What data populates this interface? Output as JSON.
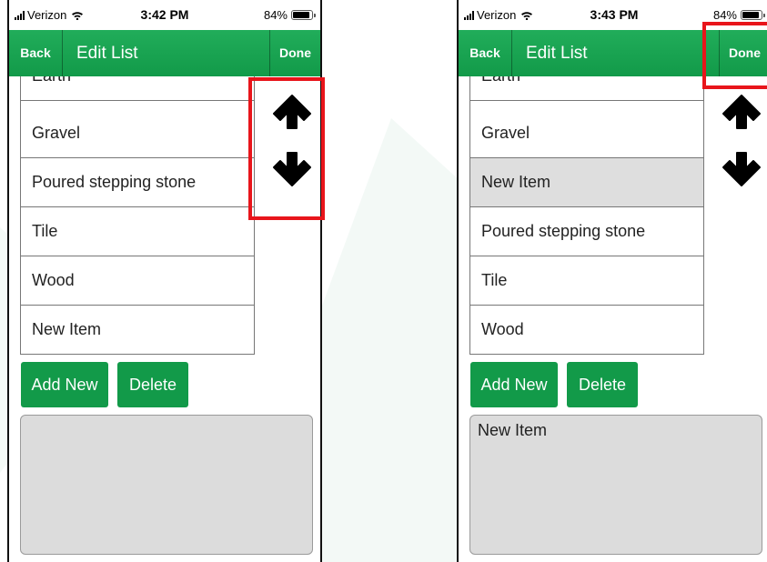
{
  "colors": {
    "nav_green": "#1aa552",
    "button_green": "#129a49",
    "highlight_red": "#e8151b",
    "selected_row": "#dedede"
  },
  "screens": [
    {
      "status": {
        "carrier": "Verizon",
        "time": "3:42 PM",
        "battery": "84%"
      },
      "nav": {
        "back": "Back",
        "title": "Edit List",
        "done": "Done"
      },
      "list_items": [
        {
          "label": "Earth",
          "selected": false
        },
        {
          "label": "Gravel",
          "selected": false
        },
        {
          "label": "Poured stepping stone",
          "selected": false
        },
        {
          "label": "Tile",
          "selected": false
        },
        {
          "label": "Wood",
          "selected": false
        },
        {
          "label": "New Item",
          "selected": false
        }
      ],
      "buttons": {
        "add_new": "Add New",
        "delete": "Delete"
      },
      "edit_text": "",
      "icons": [
        "move-up-arrow-icon",
        "move-down-arrow-icon"
      ],
      "highlight_target": "move-arrows"
    },
    {
      "status": {
        "carrier": "Verizon",
        "time": "3:43 PM",
        "battery": "84%"
      },
      "nav": {
        "back": "Back",
        "title": "Edit List",
        "done": "Done"
      },
      "list_items": [
        {
          "label": "Earth",
          "selected": false
        },
        {
          "label": "Gravel",
          "selected": false
        },
        {
          "label": "New Item",
          "selected": true
        },
        {
          "label": "Poured stepping stone",
          "selected": false
        },
        {
          "label": "Tile",
          "selected": false
        },
        {
          "label": "Wood",
          "selected": false
        }
      ],
      "buttons": {
        "add_new": "Add New",
        "delete": "Delete"
      },
      "edit_text": "New Item",
      "icons": [
        "move-up-arrow-icon",
        "move-down-arrow-icon"
      ],
      "highlight_target": "done-button"
    }
  ]
}
